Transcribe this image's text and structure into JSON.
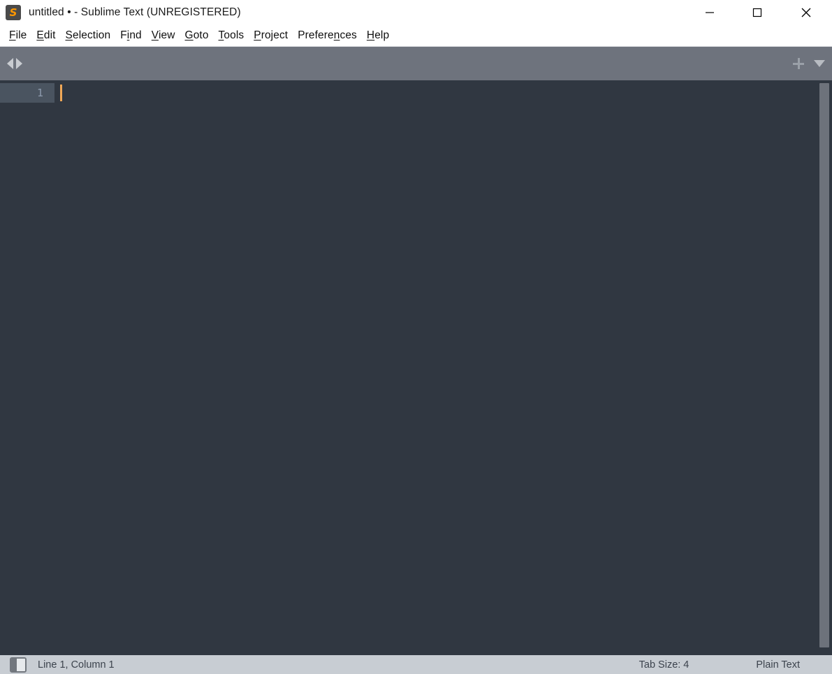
{
  "window": {
    "title": "untitled • - Sublime Text (UNREGISTERED)",
    "logo_icon": "sublime-text-logo",
    "logo_glyph": "S",
    "controls": {
      "minimize": "minimize-icon",
      "maximize": "maximize-icon",
      "close": "close-icon"
    }
  },
  "menubar": {
    "items": [
      {
        "label": "File",
        "pre": "",
        "mnemonic": "F",
        "post": "ile"
      },
      {
        "label": "Edit",
        "pre": "",
        "mnemonic": "E",
        "post": "dit"
      },
      {
        "label": "Selection",
        "pre": "",
        "mnemonic": "S",
        "post": "election"
      },
      {
        "label": "Find",
        "pre": "F",
        "mnemonic": "i",
        "post": "nd"
      },
      {
        "label": "View",
        "pre": "",
        "mnemonic": "V",
        "post": "iew"
      },
      {
        "label": "Goto",
        "pre": "",
        "mnemonic": "G",
        "post": "oto"
      },
      {
        "label": "Tools",
        "pre": "",
        "mnemonic": "T",
        "post": "ools"
      },
      {
        "label": "Project",
        "pre": "",
        "mnemonic": "P",
        "post": "roject"
      },
      {
        "label": "Preferences",
        "pre": "Prefere",
        "mnemonic": "n",
        "post": "ces"
      },
      {
        "label": "Help",
        "pre": "",
        "mnemonic": "H",
        "post": "elp"
      }
    ]
  },
  "tabbar": {
    "prev_icon": "chevron-left-icon",
    "next_icon": "chevron-right-icon",
    "new_tab_icon": "plus-icon",
    "tab_menu_icon": "chevron-down-icon",
    "tabs": []
  },
  "editor": {
    "line_numbers": [
      "1"
    ],
    "content": "",
    "caret_line": 1,
    "caret_column": 1
  },
  "statusbar": {
    "sidebar_toggle_icon": "sidebar-toggle-icon",
    "line_column": "Line 1, Column 1",
    "tab_size": "Tab Size: 4",
    "syntax": "Plain Text"
  },
  "colors": {
    "titlebar_bg": "#ffffff",
    "menubar_bg": "#ffffff",
    "tabbar_bg": "#6e737d",
    "editor_bg": "#303741",
    "gutter_highlight": "#4a5460",
    "line_number_fg": "#8d9aad",
    "caret": "#efa757",
    "statusbar_bg": "#c8cdd3",
    "statusbar_fg": "#3c434d",
    "accent_orange": "#ff9800",
    "scrollbar_thumb": "#6d727b"
  }
}
